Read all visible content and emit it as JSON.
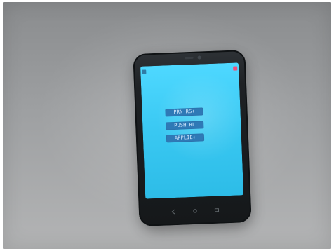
{
  "scene": {
    "surface_color": "#9c9ea0",
    "phone_body_color": "#1d2023",
    "screen_color": "#3fd0f8",
    "button_color": "#2f79b6"
  },
  "phone_ui": {
    "status_icons": {
      "left": "app-icon",
      "right": "record-icon"
    },
    "buttons": [
      {
        "label": "PRN RS+"
      },
      {
        "label": "PUSH RL"
      },
      {
        "label": "APPLIE+"
      }
    ],
    "navigation_icons": [
      "back-icon",
      "home-icon",
      "recent-apps-icon"
    ]
  }
}
